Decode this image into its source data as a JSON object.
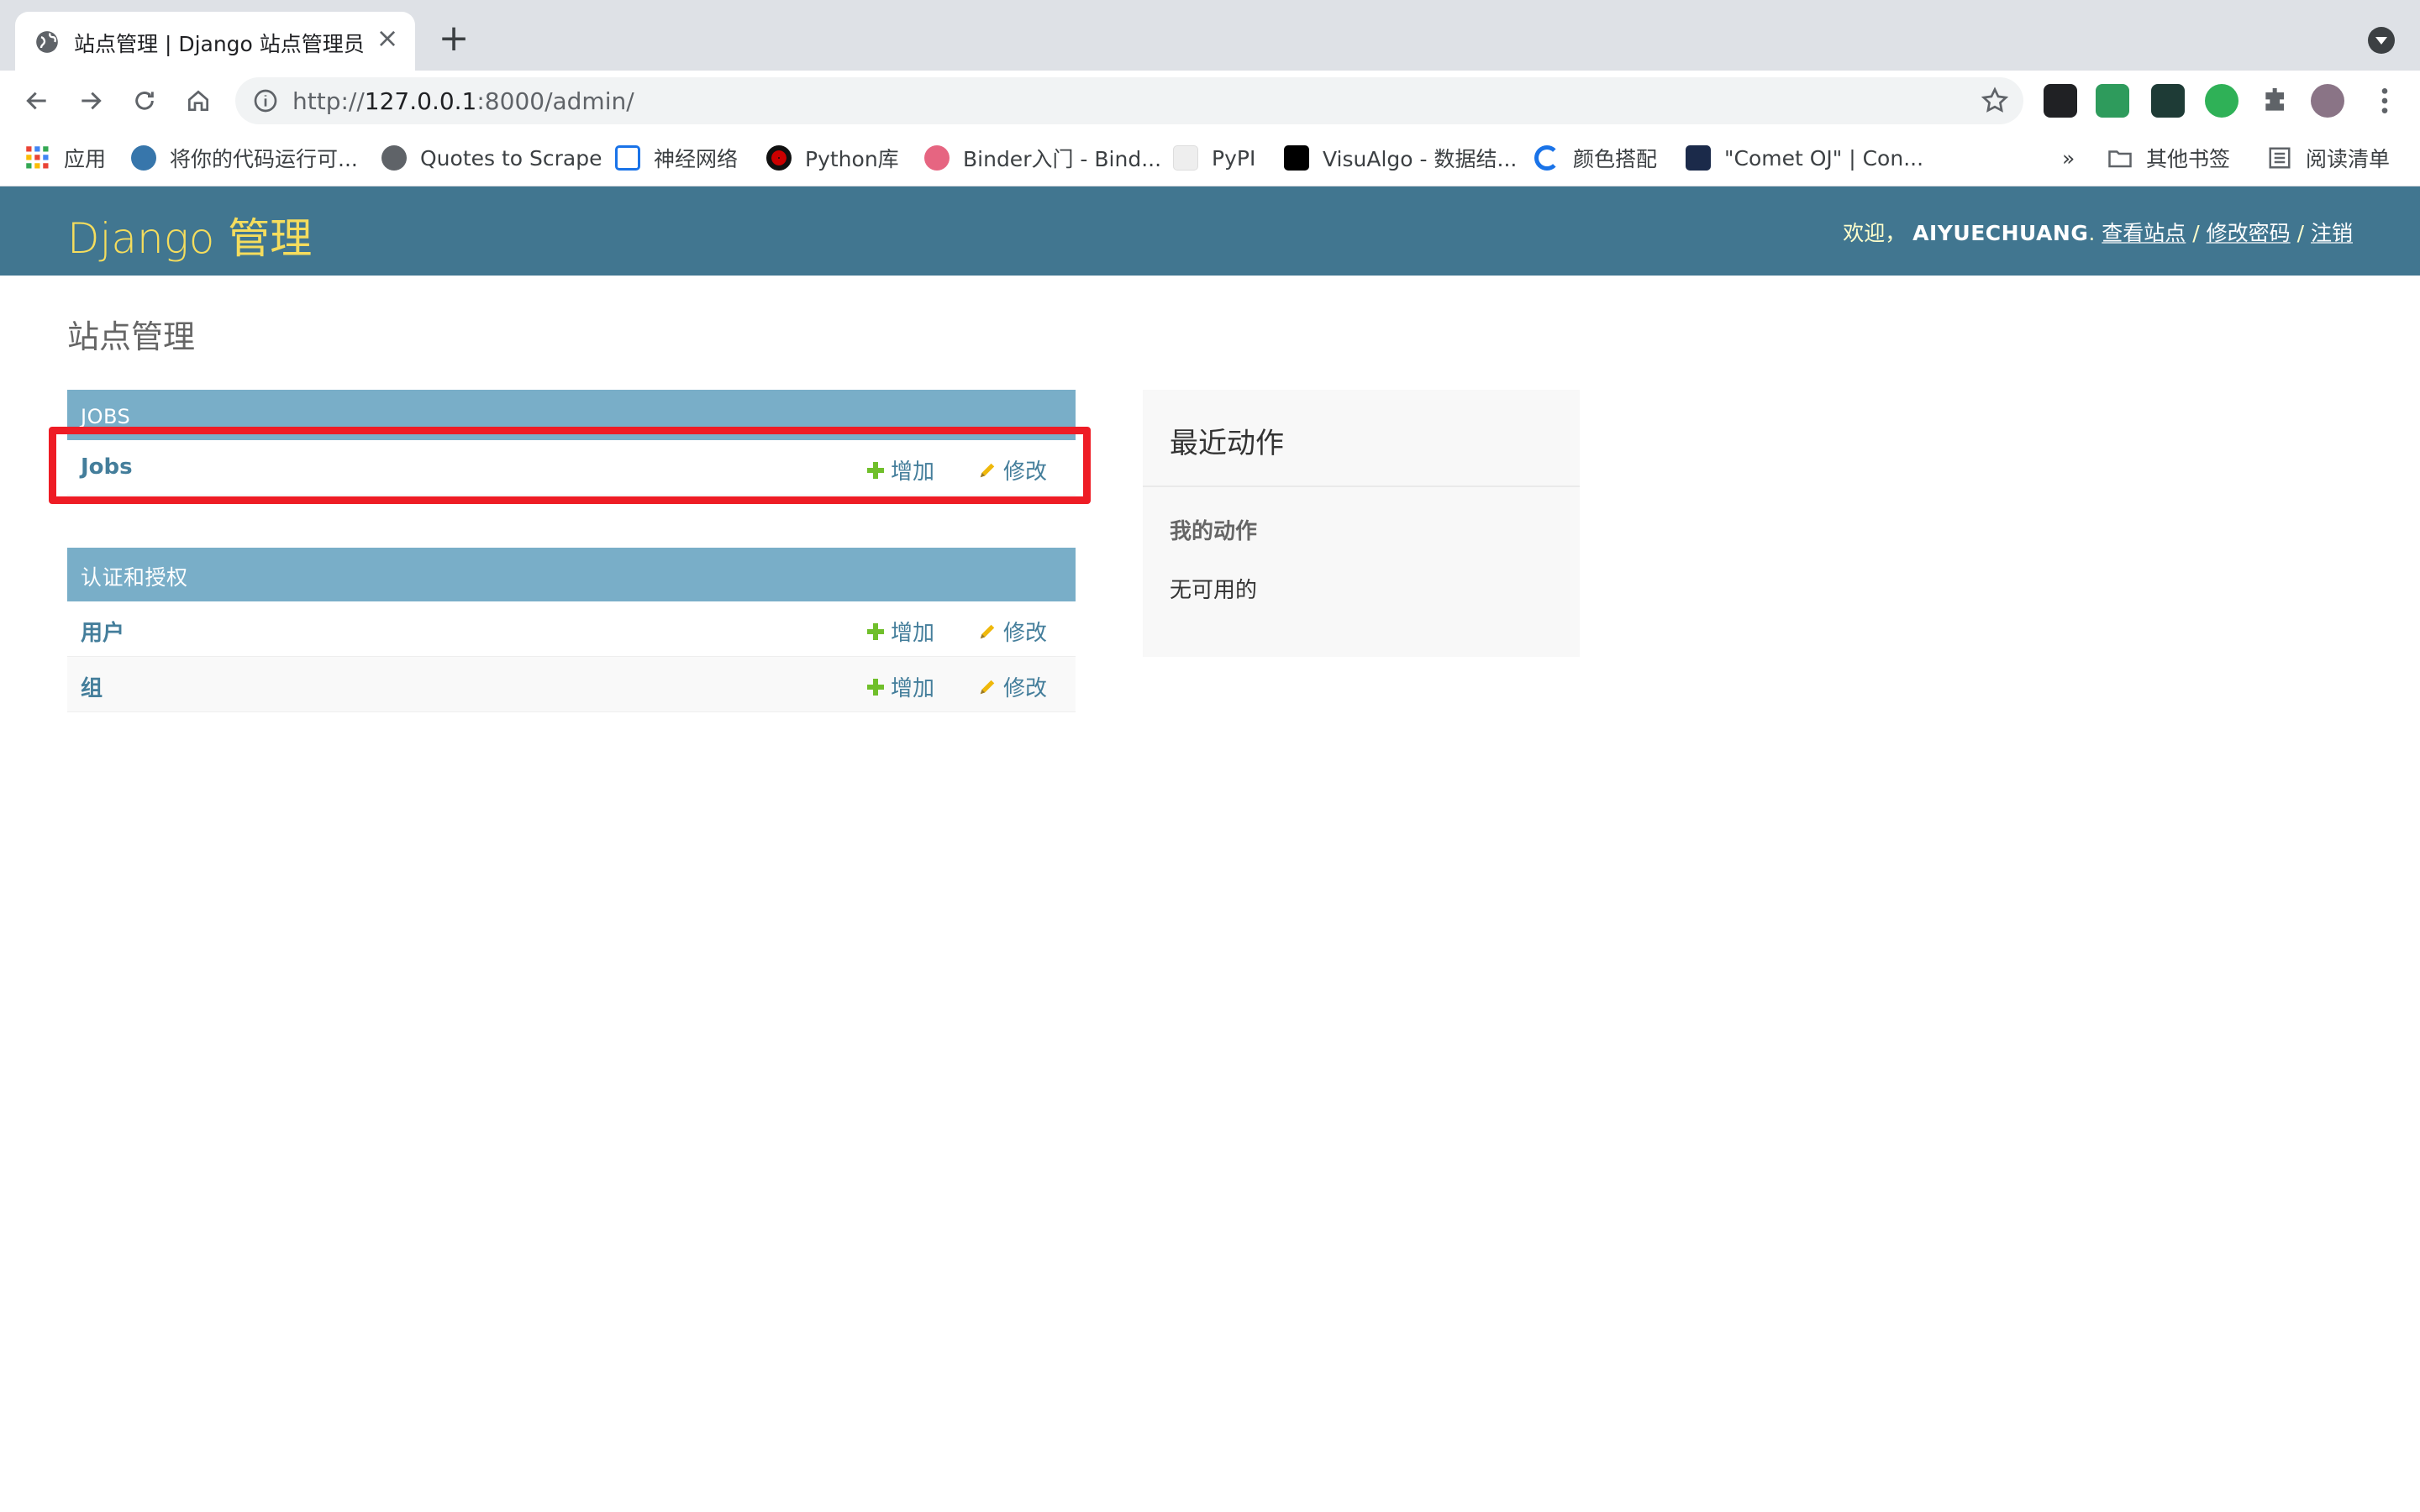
{
  "browser": {
    "tab_title": "站点管理 | Django 站点管理员",
    "url_prefix": "http://",
    "url_host": "127.0.0.1",
    "url_rest": ":8000/admin/"
  },
  "bookmarks": {
    "items": [
      {
        "label": "应用",
        "color": "#ea4335"
      },
      {
        "label": "将你的代码运行可...",
        "color": "#3776ab"
      },
      {
        "label": "Quotes to Scrape",
        "color": "#5f6368"
      },
      {
        "label": "神经网络",
        "color": "#1a73e8"
      },
      {
        "label": "Python库",
        "color": "#c00"
      },
      {
        "label": "Binder入门 - Bind...",
        "color": "#e66581"
      },
      {
        "label": "PyPI",
        "color": "#ddd"
      },
      {
        "label": "VisuAlgo - 数据结...",
        "color": "#000"
      },
      {
        "label": "颜色搭配",
        "color": "#1a73e8"
      },
      {
        "label": "\"Comet OJ\" | Con...",
        "color": "#1b2a4a"
      }
    ],
    "overflow": "»",
    "other_bookmarks": "其他书签",
    "reading_list": "阅读清单"
  },
  "header": {
    "brand": "Django 管理",
    "welcome": "欢迎，",
    "username": "AIYUECHUANG",
    "view_site": "查看站点",
    "change_password": "修改密码",
    "logout": "注销",
    "sep": " / "
  },
  "page": {
    "title": "站点管理"
  },
  "apps": [
    {
      "caption": "JOBS",
      "models": [
        {
          "name": "Jobs",
          "add": "增加",
          "change": "修改"
        }
      ]
    },
    {
      "caption": "认证和授权",
      "models": [
        {
          "name": "用户",
          "add": "增加",
          "change": "修改"
        },
        {
          "name": "组",
          "add": "增加",
          "change": "修改"
        }
      ]
    }
  ],
  "recent": {
    "title": "最近动作",
    "subtitle": "我的动作",
    "empty": "无可用的"
  },
  "colors": {
    "header_bg": "#417690",
    "brand": "#f5dd5d",
    "caption_bg": "#79aec8",
    "link": "#447e9b",
    "add_icon": "#70bf2b",
    "change_icon": "#efb80b",
    "highlight": "#ee1c25"
  }
}
